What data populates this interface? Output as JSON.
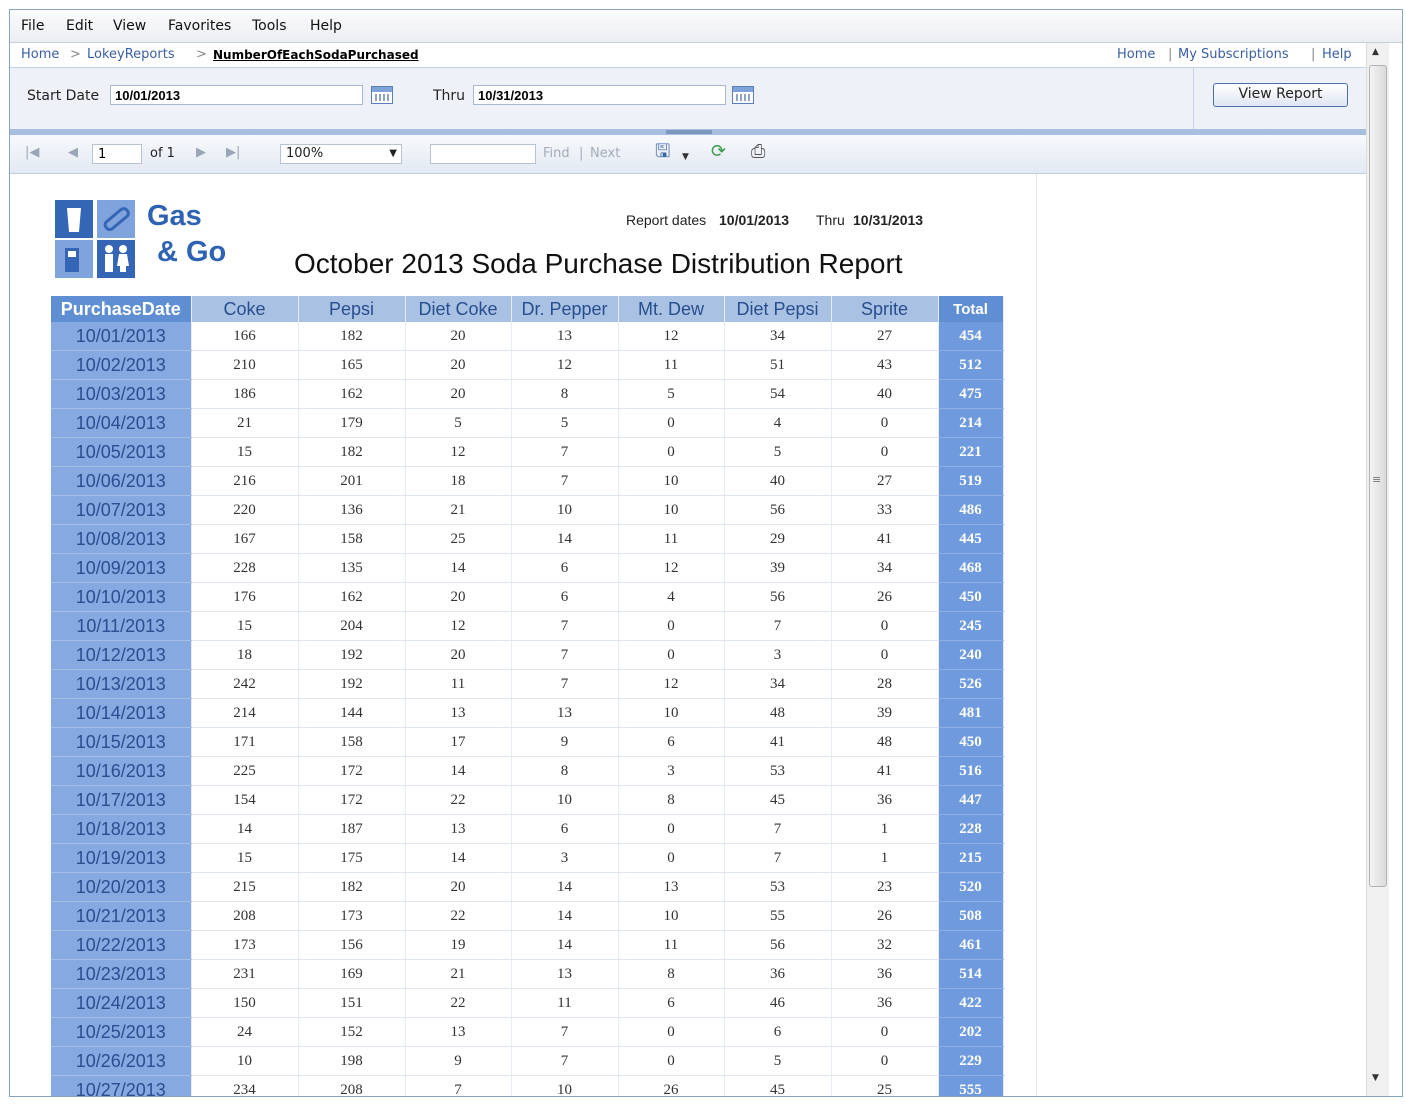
{
  "menu": [
    "File",
    "Edit",
    "View",
    "Favorites",
    "Tools",
    "Help"
  ],
  "breadcrumb": {
    "home": "Home",
    "sep1": ">",
    "folder": "LokeyReports",
    "sep2": ">",
    "current": "NumberOfEachSodaPurchased"
  },
  "top_links": {
    "home": "Home",
    "sep1": "|",
    "subscriptions": "My Subscriptions",
    "sep2": "|",
    "help": "Help"
  },
  "params": {
    "start_label": "Start Date",
    "start_value": "10/01/2013",
    "thru_label": "Thru",
    "thru_value": "10/31/2013",
    "view_report": "View Report"
  },
  "toolbar": {
    "page_value": "1",
    "of_label": "of 1",
    "zoom": "100%",
    "find_value": "",
    "find": "Find",
    "separator": "|",
    "next": "Next"
  },
  "icons": {
    "first": "first-page-icon",
    "prev": "prev-page-icon",
    "next": "next-page-icon",
    "last": "last-page-icon",
    "export": "save-export-icon",
    "refresh": "refresh-icon",
    "print": "print-icon",
    "calendar": "calendar-icon"
  },
  "report": {
    "logo_line1": "Gas",
    "logo_line2": "& Go",
    "dates_label": "Report dates",
    "dates_start": "10/01/2013",
    "dates_thru": "Thru",
    "dates_end": "10/31/2013",
    "title": "October 2013 Soda Purchase Distribution  Report"
  },
  "table": {
    "headers": [
      "PurchaseDate",
      "Coke",
      "Pepsi",
      "Diet Coke",
      "Dr. Pepper",
      "Mt. Dew",
      "Diet Pepsi",
      "Sprite",
      "Total"
    ],
    "rows": [
      [
        "10/01/2013",
        "166",
        "182",
        "20",
        "13",
        "12",
        "34",
        "27",
        "454"
      ],
      [
        "10/02/2013",
        "210",
        "165",
        "20",
        "12",
        "11",
        "51",
        "43",
        "512"
      ],
      [
        "10/03/2013",
        "186",
        "162",
        "20",
        "8",
        "5",
        "54",
        "40",
        "475"
      ],
      [
        "10/04/2013",
        "21",
        "179",
        "5",
        "5",
        "0",
        "4",
        "0",
        "214"
      ],
      [
        "10/05/2013",
        "15",
        "182",
        "12",
        "7",
        "0",
        "5",
        "0",
        "221"
      ],
      [
        "10/06/2013",
        "216",
        "201",
        "18",
        "7",
        "10",
        "40",
        "27",
        "519"
      ],
      [
        "10/07/2013",
        "220",
        "136",
        "21",
        "10",
        "10",
        "56",
        "33",
        "486"
      ],
      [
        "10/08/2013",
        "167",
        "158",
        "25",
        "14",
        "11",
        "29",
        "41",
        "445"
      ],
      [
        "10/09/2013",
        "228",
        "135",
        "14",
        "6",
        "12",
        "39",
        "34",
        "468"
      ],
      [
        "10/10/2013",
        "176",
        "162",
        "20",
        "6",
        "4",
        "56",
        "26",
        "450"
      ],
      [
        "10/11/2013",
        "15",
        "204",
        "12",
        "7",
        "0",
        "7",
        "0",
        "245"
      ],
      [
        "10/12/2013",
        "18",
        "192",
        "20",
        "7",
        "0",
        "3",
        "0",
        "240"
      ],
      [
        "10/13/2013",
        "242",
        "192",
        "11",
        "7",
        "12",
        "34",
        "28",
        "526"
      ],
      [
        "10/14/2013",
        "214",
        "144",
        "13",
        "13",
        "10",
        "48",
        "39",
        "481"
      ],
      [
        "10/15/2013",
        "171",
        "158",
        "17",
        "9",
        "6",
        "41",
        "48",
        "450"
      ],
      [
        "10/16/2013",
        "225",
        "172",
        "14",
        "8",
        "3",
        "53",
        "41",
        "516"
      ],
      [
        "10/17/2013",
        "154",
        "172",
        "22",
        "10",
        "8",
        "45",
        "36",
        "447"
      ],
      [
        "10/18/2013",
        "14",
        "187",
        "13",
        "6",
        "0",
        "7",
        "1",
        "228"
      ],
      [
        "10/19/2013",
        "15",
        "175",
        "14",
        "3",
        "0",
        "7",
        "1",
        "215"
      ],
      [
        "10/20/2013",
        "215",
        "182",
        "20",
        "14",
        "13",
        "53",
        "23",
        "520"
      ],
      [
        "10/21/2013",
        "208",
        "173",
        "22",
        "14",
        "10",
        "55",
        "26",
        "508"
      ],
      [
        "10/22/2013",
        "173",
        "156",
        "19",
        "14",
        "11",
        "56",
        "32",
        "461"
      ],
      [
        "10/23/2013",
        "231",
        "169",
        "21",
        "13",
        "8",
        "36",
        "36",
        "514"
      ],
      [
        "10/24/2013",
        "150",
        "151",
        "22",
        "11",
        "6",
        "46",
        "36",
        "422"
      ],
      [
        "10/25/2013",
        "24",
        "152",
        "13",
        "7",
        "0",
        "6",
        "0",
        "202"
      ],
      [
        "10/26/2013",
        "10",
        "198",
        "9",
        "7",
        "0",
        "5",
        "0",
        "229"
      ],
      [
        "10/27/2013",
        "234",
        "208",
        "7",
        "10",
        "26",
        "45",
        "25",
        "555"
      ]
    ]
  },
  "colors": {
    "header_blue": "#a9c2e4",
    "date_blue": "#85a9e0",
    "total_blue": "#6f9bde",
    "link_blue": "#3a5fa4"
  }
}
